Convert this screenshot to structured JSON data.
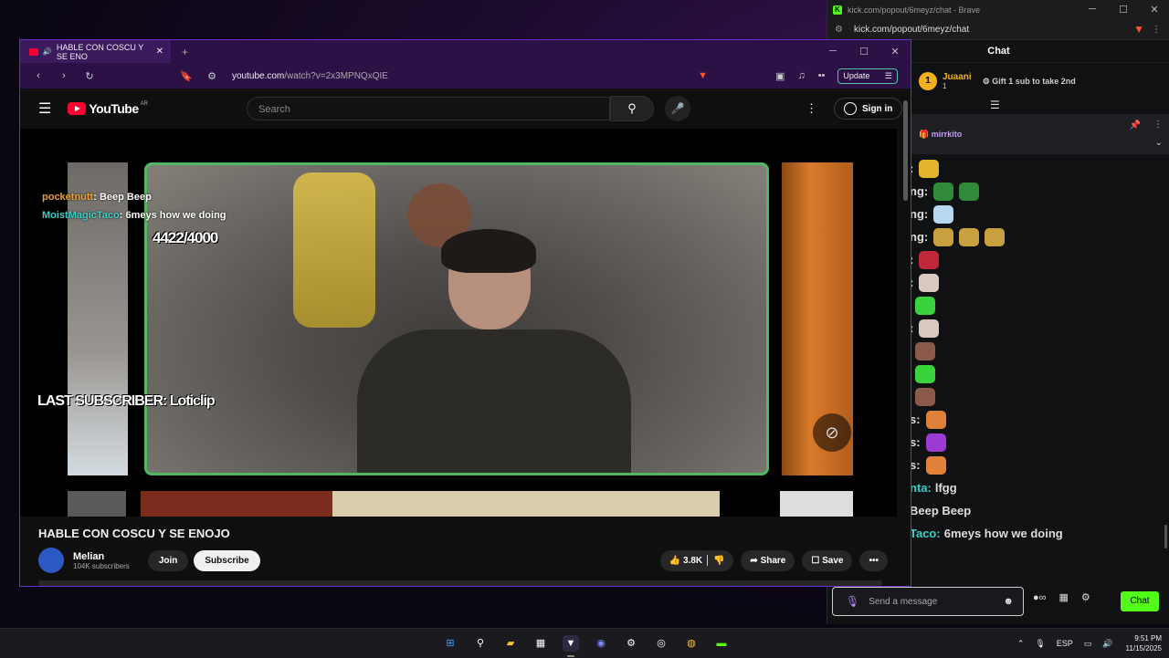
{
  "kick": {
    "window_title": "kick.com/popout/6meyz/chat - Brave",
    "url": "kick.com/popout/6meyz/chat",
    "header": "Chat",
    "leader": {
      "rank": "1",
      "name": "Juaani",
      "count": "1"
    },
    "gift_text": "Gift 1 sub to take 2nd",
    "pinned_user": "mirrkito",
    "messages": [
      {
        "name": "",
        "text": ":",
        "emotes": [
          "#e2b52a"
        ]
      },
      {
        "name": "",
        "text": "ng:",
        "emotes": [
          "#2f8a3a",
          "#2f8a3a"
        ]
      },
      {
        "name": "",
        "text": "ng:",
        "emotes": [
          "#b9d6f0"
        ]
      },
      {
        "name": "",
        "text": "ng:",
        "emotes": [
          "#c9a040",
          "#c9a040",
          "#c9a040"
        ]
      },
      {
        "name": "",
        "text": ":",
        "emotes": [
          "#c0283a"
        ]
      },
      {
        "name": "",
        "text": ":",
        "emotes": [
          "#d9c8c0"
        ]
      },
      {
        "name": "",
        "text": "",
        "emotes": [
          "#3bd33b"
        ]
      },
      {
        "name": "",
        "text": ":",
        "emotes": [
          "#d9c8c0"
        ]
      },
      {
        "name": "",
        "text": "",
        "emotes": [
          "#8b5a4a"
        ]
      },
      {
        "name": "",
        "text": "",
        "emotes": [
          "#3bd33b"
        ]
      },
      {
        "name": "",
        "text": "",
        "emotes": [
          "#8b5a4a"
        ]
      },
      {
        "name": "",
        "text": "s:",
        "emotes": [
          "#e0813a"
        ]
      },
      {
        "name": "",
        "text": "s:",
        "emotes": [
          "#9b3bd3"
        ]
      },
      {
        "name": "",
        "text": "s:",
        "emotes": [
          "#e0813a"
        ]
      },
      {
        "name": "nta:",
        "text": "lfgg",
        "emotes": []
      },
      {
        "name": "",
        "text": "Beep Beep",
        "emotes": []
      },
      {
        "name": "Taco:",
        "text": "6meys how we doing",
        "emotes": []
      }
    ],
    "input_placeholder": "Send a message",
    "chat_button": "Chat"
  },
  "youtube": {
    "tab_title": "HABLE CON COSCU Y SE ENO",
    "url_host": "youtube.com",
    "url_path": "/watch?v=2x3MPNQxQIE",
    "update_label": "Update",
    "logo_text": "YouTube",
    "country_code": "AR",
    "search_placeholder": "Search",
    "signin_label": "Sign in",
    "overlay": {
      "chat": [
        {
          "user": "pocketnutt",
          "text": ": Beep Beep"
        },
        {
          "user": "MoistMagicTaco",
          "text": ": 6meys how we doing"
        }
      ],
      "goal": "4422/4000",
      "last_subscriber": "LAST SUBSCRIBER: Loticlip"
    },
    "video_title": "HABLE CON COSCU Y SE ENOJO",
    "channel_name": "Melian",
    "subscribers": "104K subscribers",
    "join_label": "Join",
    "subscribe_label": "Subscribe",
    "likes": "3.8K",
    "share_label": "Share",
    "save_label": "Save"
  },
  "taskbar": {
    "language": "ESP",
    "time": "9:51 PM",
    "date": "11/15/2025"
  },
  "colors": {
    "accent_purple": "#6a2dc9",
    "kick_green": "#53fc18",
    "yt_red": "#ff0033"
  }
}
